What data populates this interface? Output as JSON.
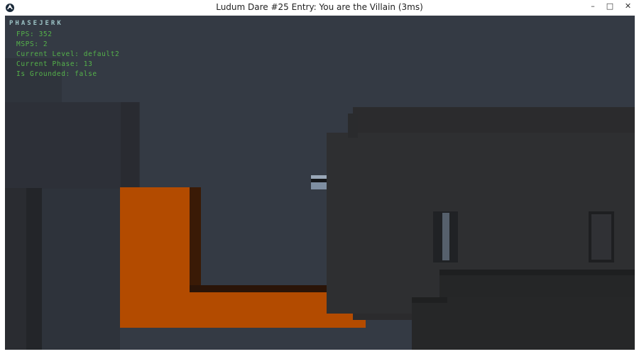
{
  "window": {
    "title": "Ludum Dare #25 Entry: You are the Villain (3ms)",
    "controls": {
      "minimize": "–",
      "maximize": "□",
      "close": "✕"
    }
  },
  "hud": {
    "game_title": "PHASEJERK",
    "lines": [
      "FPS: 352",
      "MSPS: 2",
      "Current Level: default2",
      "Current Phase: 13",
      "Is Grounded: false"
    ]
  },
  "colors": {
    "background": "#343a44",
    "player_block": "#b34b00",
    "hud_text": "#55b24a",
    "hud_title": "#9cc3c6"
  }
}
